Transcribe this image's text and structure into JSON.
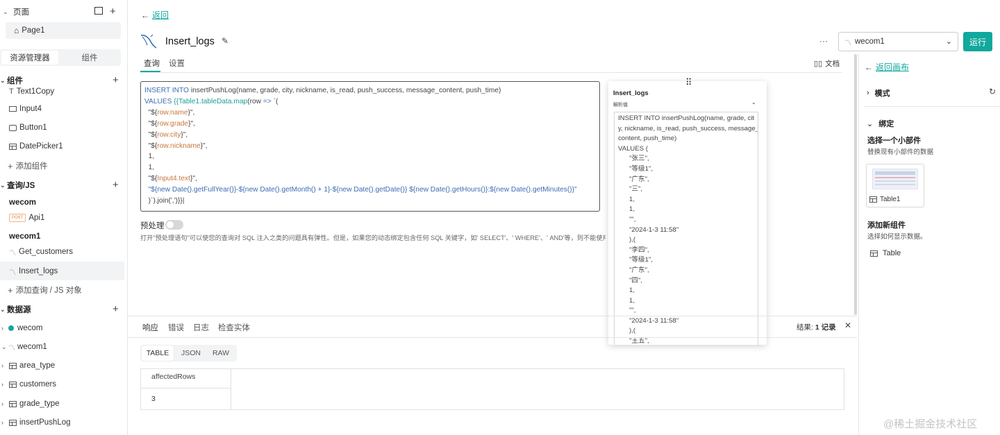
{
  "sidebar": {
    "pages_label": "页面",
    "page1": "Page1",
    "tab_resources": "资源管理器",
    "tab_widgets": "组件",
    "widgets_section": "组件",
    "widgets": [
      "Text1Copy",
      "Input4",
      "Button1",
      "DatePicker1"
    ],
    "add_widget": "添加组件",
    "queries_section": "查询/JS",
    "group_wecom": "wecom",
    "api_method": "POST",
    "api1": "Api1",
    "group_wecom1": "wecom1",
    "get_customers": "Get_customers",
    "insert_logs": "Insert_logs",
    "add_query": "添加查询 / JS 对象",
    "datasources_section": "数据源",
    "ds_wecom": "wecom",
    "ds_wecom1": "wecom1",
    "tables": [
      "area_type",
      "customers",
      "grade_type",
      "insertPushLog"
    ]
  },
  "header": {
    "back": "返回",
    "query_name": "Insert_logs",
    "more": "···",
    "datasource_selected": "wecom1",
    "run": "运行"
  },
  "tabs": {
    "query": "查询",
    "settings": "设置",
    "docs": "文档"
  },
  "editor": {
    "line1_kw": "INSERT INTO",
    "line1_rest": " insertPushLog(name, grade, city, nickname, is_read, push_success, message_content, push_time)",
    "line2_kw": "VALUES",
    "line2_a": " {{",
    "line2_b": "Table1.tableData.map",
    "line2_c": "(row ",
    "line2_d": "=>",
    "line2_e": " `(",
    "l3a": "  \"${",
    "l3b": "row.name",
    "l3c": "}\",",
    "l4b": "row.grade",
    "l5b": "row.city",
    "l6b": "row.nickname",
    "l7": "  1,",
    "l8": "  1,",
    "l9b": "Input4.text",
    "l10": "  \"${new Date().getFullYear()}-${new Date().getMonth() + 1}-${new Date().getDate()} ${new Date().getHours()}:${new Date().getMinutes()}\"",
    "l11a": "  )`).join(',')}}",
    "l11b": "|"
  },
  "prepared": {
    "label": "预处理",
    "desc": "打开\"预处理语句\"可以使您的查询对 SQL 注入之类的问题具有弹性。但是，如果您的动态绑定包含任何 SQL 关键字，如' SELECT'、' WHERE'、' AND'等，则不能使用它。"
  },
  "popup": {
    "title": "Insert_logs",
    "subtitle": "解析值",
    "lines": [
      "INSERT INTO insertPushLog(name, grade, cit",
      "y, nickname, is_read, push_success, message_",
      "content, push_time)",
      "VALUES (",
      "      \"张三\",",
      "      \"等级1\",",
      "      \"广东\",",
      "      \"三\",",
      "      1,",
      "      1,",
      "      \"\",",
      "      \"2024-1-3 11:58\"",
      "      ),(",
      "      \"李四\",",
      "      \"等级1\",",
      "      \"广东\",",
      "      \"四\",",
      "      1,",
      "      1,",
      "      \"\",",
      "      \"2024-1-3 11:58\"",
      "      ),(",
      "      \"王五\","
    ]
  },
  "bottom": {
    "tabs": [
      "响应",
      "错误",
      "日志",
      "检查实体"
    ],
    "result_label": "结果: ",
    "result_value": "1 记录",
    "formats": [
      "TABLE",
      "JSON",
      "RAW"
    ],
    "column": "affectedRows",
    "value": "3"
  },
  "right": {
    "back_canvas": "返回画布",
    "mode": "模式",
    "bind": "绑定",
    "select_widget": "选择一个小部件",
    "select_widget_desc": "替换现有小部件的数据",
    "table1": "Table1",
    "add_new": "添加新组件",
    "add_new_desc": "选择如何显示数据。",
    "table": "Table"
  },
  "watermark": "@稀土掘金技术社区",
  "colors": {
    "accent": "#11a89d",
    "link": "#11a89d",
    "code_keyword": "#3b6db3",
    "code_var": "#c8763c"
  }
}
